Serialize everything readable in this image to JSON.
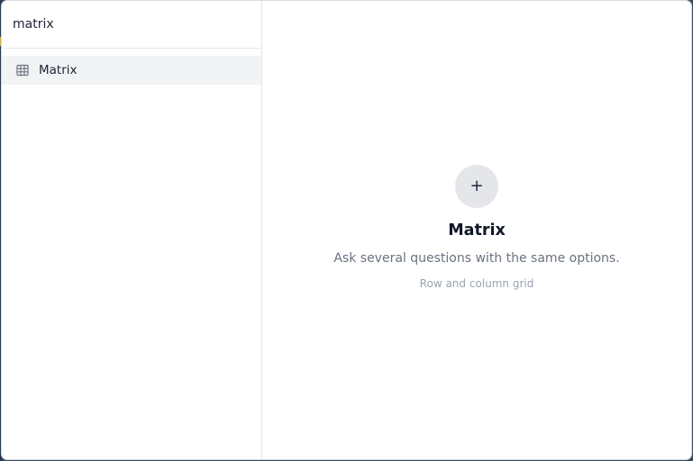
{
  "search": {
    "value": "matrix"
  },
  "results": [
    {
      "label": "Matrix",
      "icon": "table-grid-icon"
    }
  ],
  "preview": {
    "icon": "plus-icon",
    "icon_glyph": "+",
    "title": "Matrix",
    "description": "Ask several questions with the same options.",
    "hint": "Row and column grid"
  },
  "colors": {
    "selected_row_bg": "#f2f3f5",
    "icon_circle_bg": "#e4e6ea",
    "text_primary": "#1c2333",
    "text_secondary": "#6b7280",
    "text_muted": "#9ca3af"
  }
}
